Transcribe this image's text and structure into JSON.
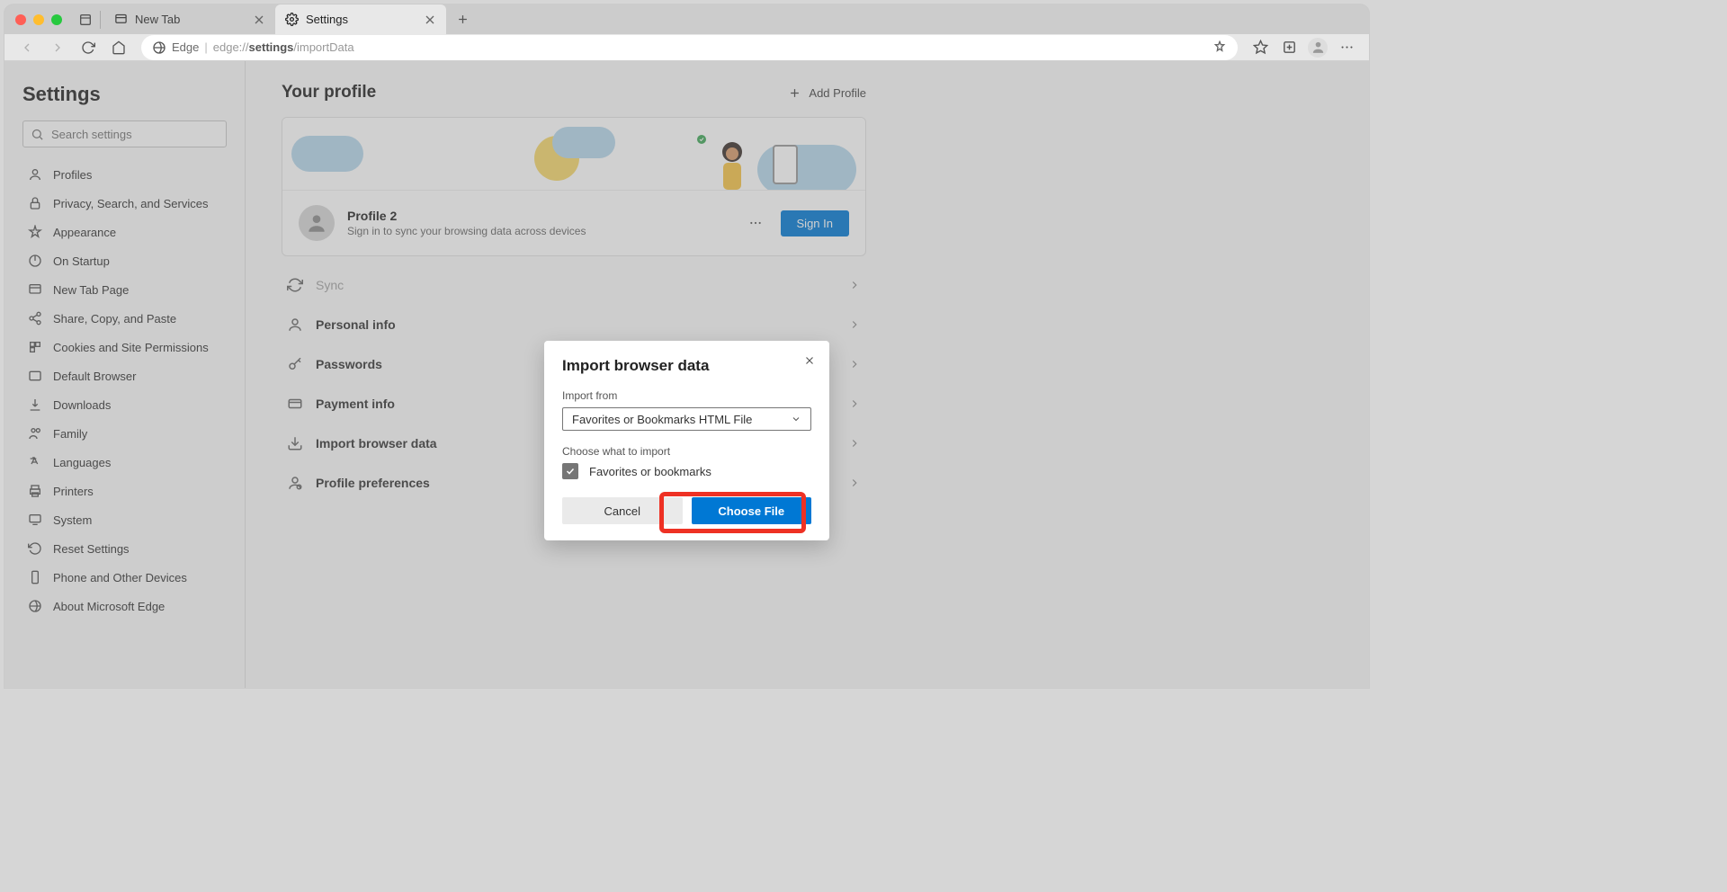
{
  "tabs": {
    "inactive": "New Tab",
    "active": "Settings"
  },
  "address": {
    "site": "Edge",
    "url_prefix": "edge://",
    "url_bold": "settings",
    "url_suffix": "/importData"
  },
  "sidebar": {
    "title": "Settings",
    "search_placeholder": "Search settings",
    "items": [
      "Profiles",
      "Privacy, Search, and Services",
      "Appearance",
      "On Startup",
      "New Tab Page",
      "Share, Copy, and Paste",
      "Cookies and Site Permissions",
      "Default Browser",
      "Downloads",
      "Family",
      "Languages",
      "Printers",
      "System",
      "Reset Settings",
      "Phone and Other Devices",
      "About Microsoft Edge"
    ]
  },
  "page": {
    "title": "Your profile",
    "add_profile": "Add Profile",
    "profile_name": "Profile 2",
    "profile_sub": "Sign in to sync your browsing data across devices",
    "more": "...",
    "sign_in": "Sign In",
    "sections": {
      "sync": "Sync",
      "personal": "Personal info",
      "passwords": "Passwords",
      "payment": "Payment info",
      "import": "Import browser data",
      "prefs": "Profile preferences"
    }
  },
  "modal": {
    "title": "Import browser data",
    "import_from": "Import from",
    "select_value": "Favorites or Bookmarks HTML File",
    "choose_what": "Choose what to import",
    "checkbox_label": "Favorites or bookmarks",
    "cancel": "Cancel",
    "choose_file": "Choose File"
  }
}
